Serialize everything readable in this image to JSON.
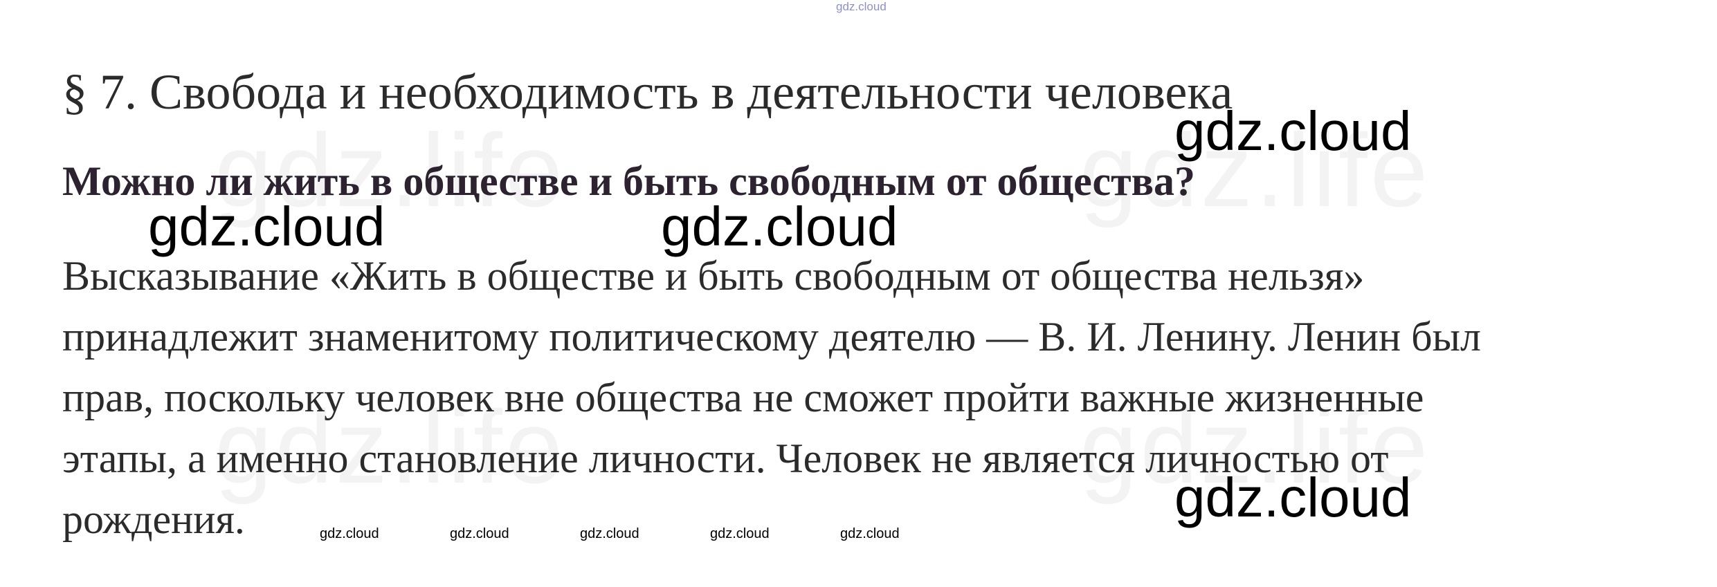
{
  "watermarks": {
    "background": "gdz.life",
    "top": "gdz.cloud",
    "large": [
      "gdz.cloud",
      "gdz.cloud",
      "gdz.cloud",
      "gdz.cloud"
    ],
    "small": [
      "gdz.cloud",
      "gdz.cloud",
      "gdz.cloud",
      "gdz.cloud",
      "gdz.cloud"
    ]
  },
  "document": {
    "title": "§ 7. Свобода и необходимость в деятельности человека",
    "question": "Можно ли жить в обществе и быть свободным от общества?",
    "paragraph_lines": [
      "Высказывание «Жить в обществе и быть свободным от общества нельзя»",
      "принадлежит знаменитому политическому деятелю — В. И. Ленину. Ленин был",
      "прав, поскольку человек вне общества не сможет пройти важные жизненные",
      "этапы, а именно становление личности. Человек не является личностью от",
      "рождения."
    ]
  },
  "colors": {
    "text": "#2b2b2b",
    "question": "#2c2230",
    "watermark": "#000000",
    "top_watermark": "#8f8fc8"
  }
}
